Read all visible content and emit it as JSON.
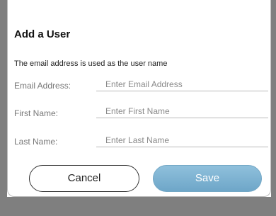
{
  "dialog": {
    "title": "Add a User",
    "subtitle": "The email address is used as the user name"
  },
  "fields": {
    "email": {
      "label": "Email Address:",
      "placeholder": "Enter Email Address",
      "value": ""
    },
    "first_name": {
      "label": "First Name:",
      "placeholder": "Enter First Name",
      "value": ""
    },
    "last_name": {
      "label": "Last Name:",
      "placeholder": "Enter Last Name",
      "value": ""
    }
  },
  "buttons": {
    "cancel_label": "Cancel",
    "save_label": "Save"
  },
  "colors": {
    "save_button": "#7fb4d4",
    "backdrop": "#7f7f7f"
  }
}
